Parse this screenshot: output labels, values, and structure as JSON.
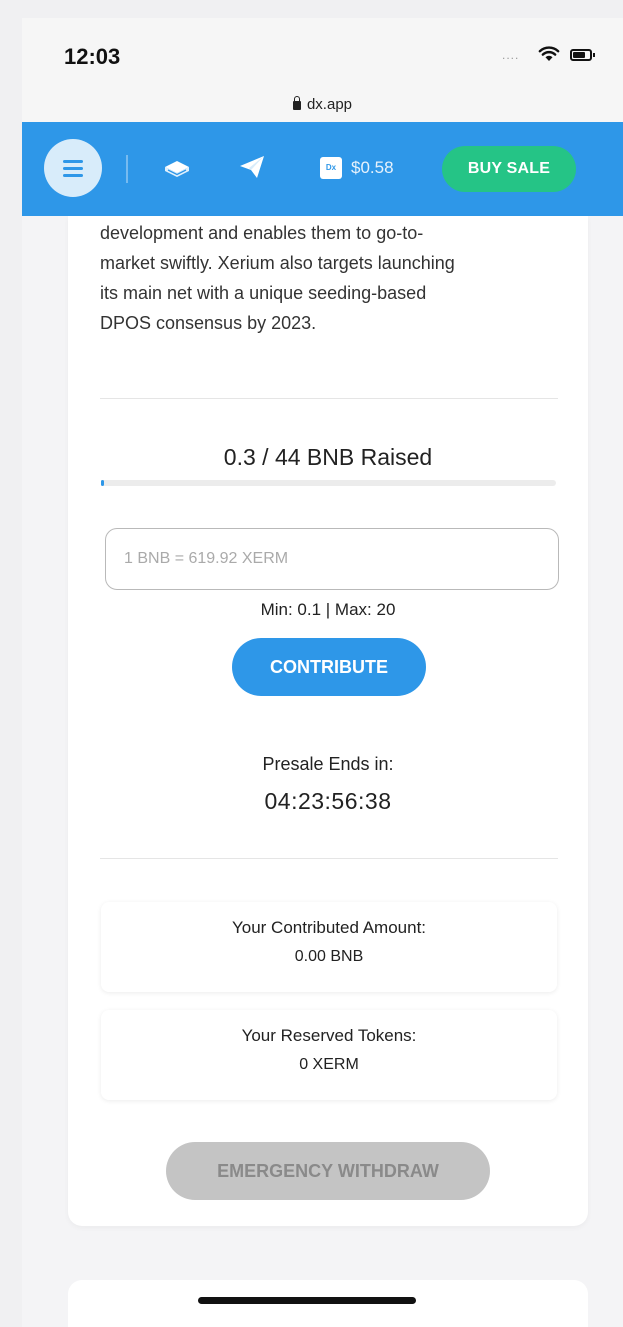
{
  "status_bar": {
    "time": "12:03",
    "signal": "....",
    "icons": [
      "wifi-icon",
      "battery-icon"
    ]
  },
  "browser": {
    "url": "dx.app"
  },
  "navbar": {
    "icons": [
      "menu-icon",
      "book-icon",
      "telegram-icon",
      "dx-logo-icon"
    ],
    "dx_logo_text": "Dx",
    "price": "$0.58",
    "buy_label": "BUY SALE",
    "colors": {
      "primary": "#2e97e8",
      "buy": "#25c486"
    }
  },
  "presale": {
    "description_lines": [
      "development and enables them to go-to-",
      "market swiftly. Xerium also targets launching",
      "its main net with a unique seeding-based",
      "DPOS consensus by 2023."
    ],
    "raised_text": "0.3 / 44 BNB Raised",
    "raised_fraction": 0.0068,
    "input_placeholder": "1 BNB = 619.92 XERM",
    "minmax_text": "Min: 0.1 | Max: 20",
    "contribute_label": "CONTRIBUTE",
    "ends_label": "Presale Ends in:",
    "countdown": "04:23:56:38",
    "contributed_label": "Your Contributed Amount:",
    "contributed_value": "0.00 BNB",
    "reserved_label": "Your Reserved Tokens:",
    "reserved_value": "0 XERM",
    "withdraw_label": "EMERGENCY WITHDRAW"
  }
}
